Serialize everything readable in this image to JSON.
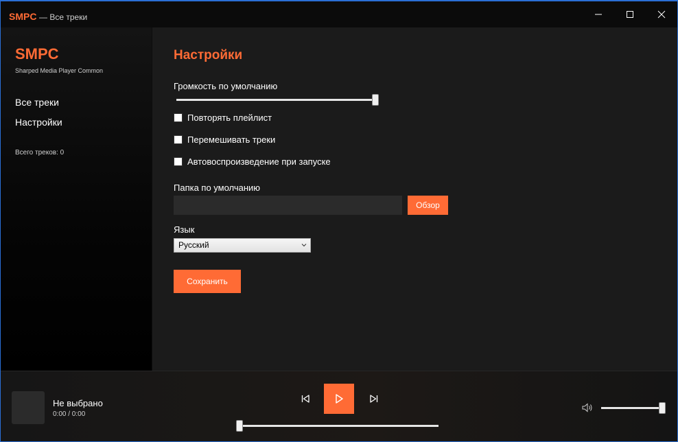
{
  "window": {
    "app_name": "SMPC",
    "subtitle": "— Все треки"
  },
  "sidebar": {
    "logo": "SMPC",
    "tagline": "Sharped Media Player Common",
    "items": [
      {
        "label": "Все треки"
      },
      {
        "label": "Настройки"
      }
    ],
    "track_count": "Всего треков: 0"
  },
  "settings": {
    "title": "Настройки",
    "volume_label": "Громкость по умолчанию",
    "volume_value": 1.0,
    "checkboxes": [
      {
        "label": "Повторять плейлист",
        "checked": false
      },
      {
        "label": "Перемешивать треки",
        "checked": false
      },
      {
        "label": "Автовоспроизведение при запуске",
        "checked": false
      }
    ],
    "folder_label": "Папка по умолчанию",
    "folder_value": "",
    "browse_label": "Обзор",
    "language_label": "Язык",
    "language_selected": "Русский",
    "save_label": "Сохранить"
  },
  "player": {
    "track_title": "Не выбрано",
    "time": "0:00 / 0:00",
    "seek_position": 0,
    "volume": 1.0
  },
  "colors": {
    "accent": "#ff6b35",
    "background": "#1b1b1b",
    "sidebar": "#050505"
  },
  "icons": {
    "minimize": "minimize-icon",
    "maximize": "maximize-icon",
    "close": "close-icon",
    "previous": "skip-previous-icon",
    "play": "play-icon",
    "next": "skip-next-icon",
    "volume": "speaker-icon",
    "dropdown": "chevron-down-icon"
  }
}
